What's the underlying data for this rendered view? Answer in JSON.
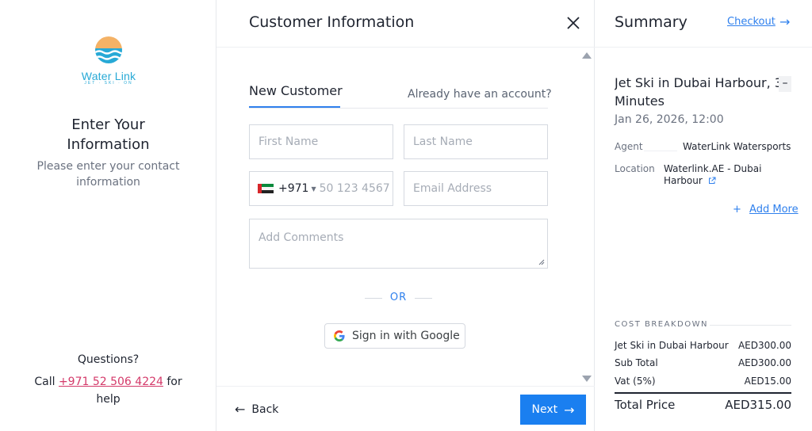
{
  "left": {
    "logo": {
      "brand": "Water Link",
      "tagline": "JET · SKI · ON"
    },
    "title_line1": "Enter Your",
    "title_line2": "Information",
    "subtitle": "Please enter your contact information",
    "help_title": "Questions?",
    "help_prefix": "Call",
    "help_phone": "+971 52 506 4224",
    "help_suffix": "for help"
  },
  "customer": {
    "title": "Customer Information",
    "tabs": {
      "new": "New Customer",
      "login": "Already have an account?"
    },
    "fields": {
      "first_name_placeholder": "First Name",
      "last_name_placeholder": "Last Name",
      "dial_code": "+971",
      "phone_placeholder": "50 123 4567",
      "email_placeholder": "Email Address",
      "comments_placeholder": "Add Comments"
    },
    "or_label": "OR",
    "google_label": "Sign in with Google",
    "back_label": "Back",
    "next_label": "Next"
  },
  "summary": {
    "title": "Summary",
    "checkout_label": "Checkout",
    "item": {
      "title_line1": "Jet Ski in Dubai Harbour, 3",
      "title_line2": "Minutes",
      "date": "Jan 26, 2026, 12:00",
      "agent_key": "Agent",
      "agent_value": "WaterLink Watersports",
      "location_key": "Location",
      "location_value": "Waterlink.AE - Dubai Harbour"
    },
    "add_more_label": "Add More",
    "cost_breakdown_label": "COST BREAKDOWN",
    "rows": [
      {
        "label": "Jet Ski in Dubai Harbour",
        "value": "AED300.00"
      },
      {
        "label": "Sub Total",
        "value": "AED300.00"
      },
      {
        "label": "Vat (5%)",
        "value": "AED15.00"
      }
    ],
    "total_label": "Total Price",
    "total_value": "AED315.00"
  },
  "colors": {
    "accent": "#1a7ff0",
    "link": "#2f80ed",
    "phone_link": "#d43a6a",
    "logo": "#27a9d6"
  }
}
